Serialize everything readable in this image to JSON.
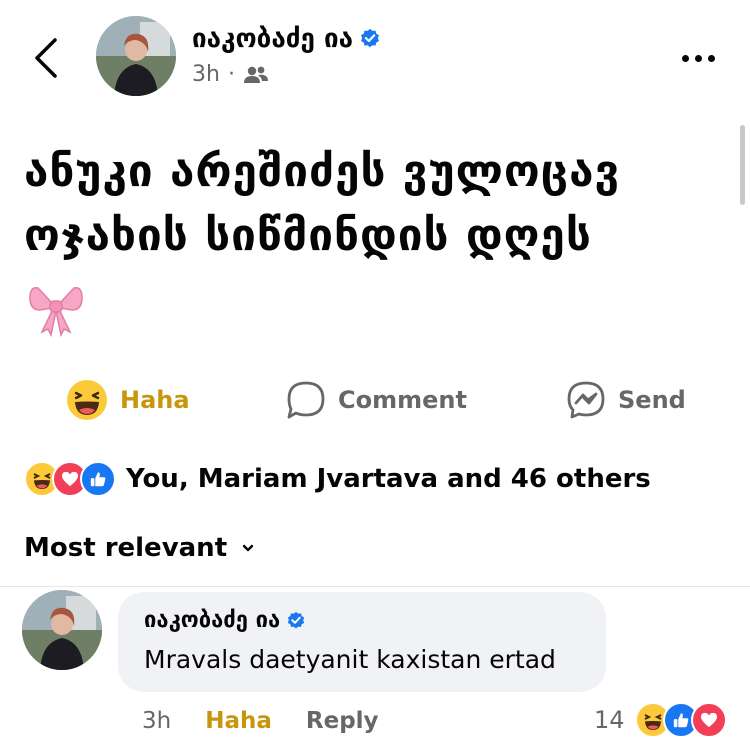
{
  "post": {
    "author": "იაკობაძე ია",
    "time": "3h",
    "separator": "·",
    "text": "ანუკი არეშიძეს ვულოცავ ოჯახის სიწმინდის დღეს",
    "emoji": "🎀"
  },
  "actions": {
    "haha_label": "Haha",
    "comment_label": "Comment",
    "send_label": "Send"
  },
  "reactions": {
    "summary": "You, Mariam Jvartava and 46 others"
  },
  "sort": {
    "label": "Most relevant"
  },
  "comment": {
    "author": "იაკობაძე ია",
    "text": "Mravals daetyanit kaxistan ertad",
    "time": "3h",
    "haha_label": "Haha",
    "reply_label": "Reply",
    "reaction_count": "14"
  },
  "colors": {
    "accent_haha": "#c7960c",
    "facebook_blue": "#1877f2",
    "love_red": "#f33e58",
    "secondary_text": "#65676b",
    "bubble_bg": "#f0f2f5"
  }
}
